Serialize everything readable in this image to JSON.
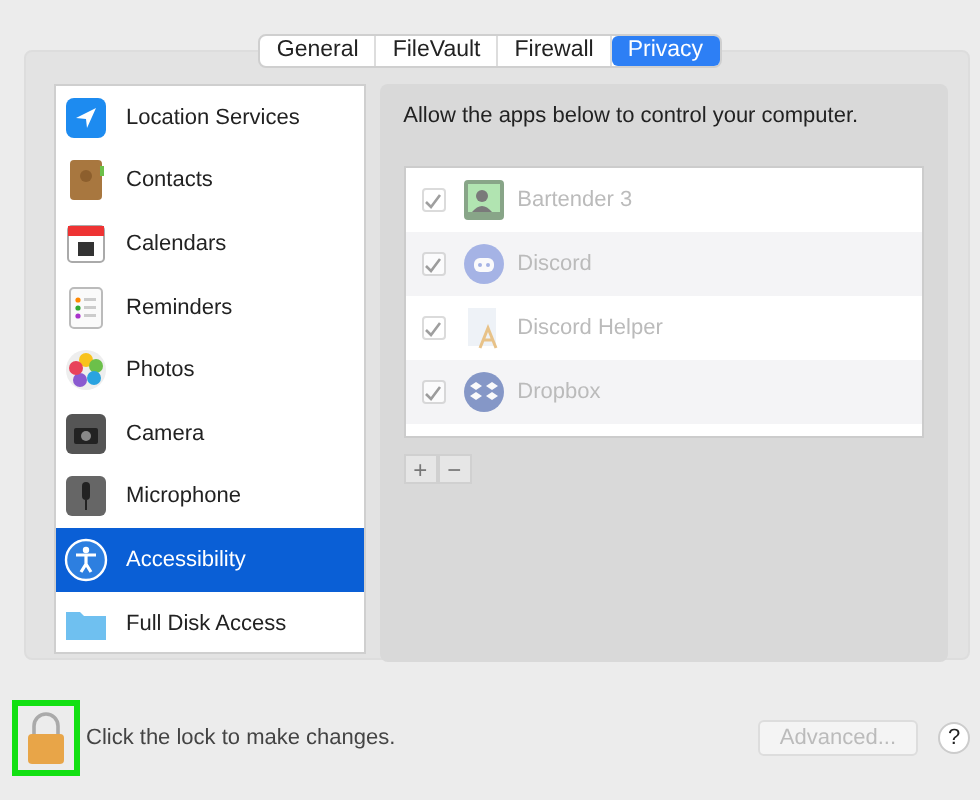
{
  "tabs": [
    {
      "label": "General",
      "selected": false
    },
    {
      "label": "FileVault",
      "selected": false
    },
    {
      "label": "Firewall",
      "selected": false
    },
    {
      "label": "Privacy",
      "selected": true
    }
  ],
  "sidebar": {
    "items": [
      {
        "label": "Location Services",
        "selected": false
      },
      {
        "label": "Contacts",
        "selected": false
      },
      {
        "label": "Calendars",
        "selected": false
      },
      {
        "label": "Reminders",
        "selected": false
      },
      {
        "label": "Photos",
        "selected": false
      },
      {
        "label": "Camera",
        "selected": false
      },
      {
        "label": "Microphone",
        "selected": false
      },
      {
        "label": "Accessibility",
        "selected": true
      },
      {
        "label": "Full Disk Access",
        "selected": false
      }
    ]
  },
  "detail": {
    "description": "Allow the apps below to control your computer.",
    "apps": [
      {
        "name": "Bartender 3",
        "checked": true,
        "disabled": true
      },
      {
        "name": "Discord",
        "checked": true,
        "disabled": true
      },
      {
        "name": "Discord Helper",
        "checked": true,
        "disabled": true
      },
      {
        "name": "Dropbox",
        "checked": true,
        "disabled": true
      }
    ],
    "buttons": [
      {
        "label": "+",
        "disabled": true
      },
      {
        "label": "−",
        "disabled": true
      }
    ]
  },
  "footer": {
    "lock_text": "Click the lock to make changes.",
    "lock_highlighted": true,
    "advanced_button": {
      "label": "Advanced...",
      "disabled": true
    },
    "help_button": "?"
  }
}
